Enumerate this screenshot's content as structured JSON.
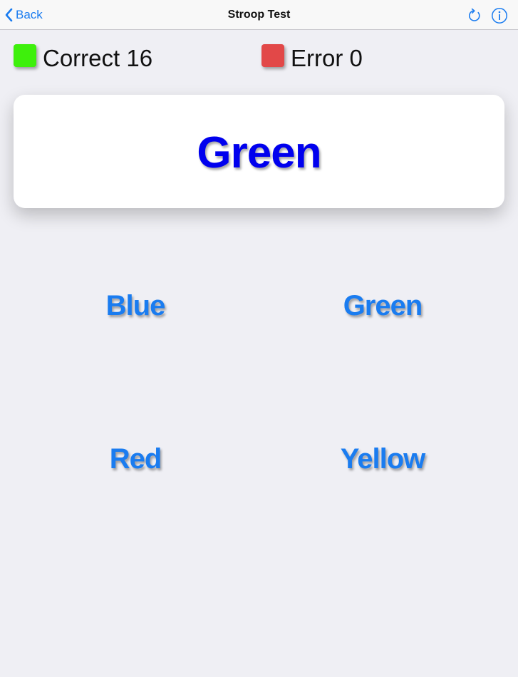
{
  "navbar": {
    "back_label": "Back",
    "title": "Stroop Test",
    "tint_color": "#1a7cf0",
    "right_icons": [
      "refresh-icon",
      "info-icon"
    ]
  },
  "score": {
    "correct_label": "Correct 16",
    "correct_color": "#3ef00c",
    "error_label": "Error 0",
    "error_color": "#e24848"
  },
  "stimulus": {
    "word": "Green",
    "ink_color": "#0000ee"
  },
  "answers": [
    {
      "label": "Blue"
    },
    {
      "label": "Green"
    },
    {
      "label": "Red"
    },
    {
      "label": "Yellow"
    }
  ]
}
